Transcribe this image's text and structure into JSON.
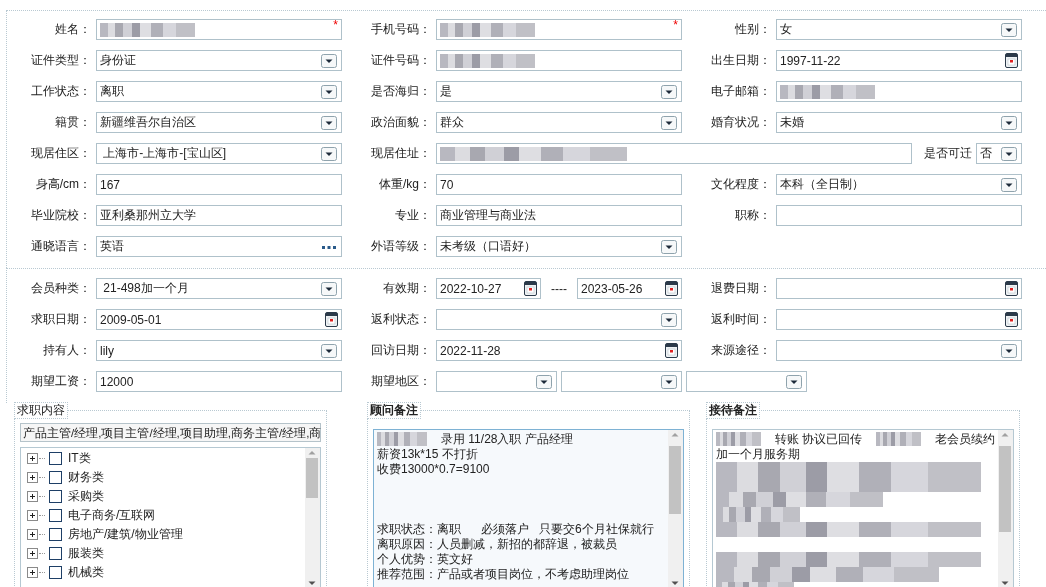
{
  "sections": [
    {
      "rows": [
        [
          {
            "label": "姓名：",
            "fields": [
              {
                "kind": "text",
                "redacted": true,
                "required_mark": "*"
              }
            ]
          },
          {
            "label": "手机号码：",
            "fields": [
              {
                "kind": "text",
                "redacted": true,
                "required_mark": "*"
              }
            ]
          },
          {
            "label": "性别：",
            "fields": [
              {
                "kind": "select",
                "value": "女"
              }
            ]
          }
        ],
        [
          {
            "label": "证件类型：",
            "fields": [
              {
                "kind": "select",
                "value": "身份证"
              }
            ]
          },
          {
            "label": "证件号码：",
            "fields": [
              {
                "kind": "text",
                "redacted": true
              }
            ]
          },
          {
            "label": "出生日期：",
            "fields": [
              {
                "kind": "date",
                "value": "1997-11-22"
              }
            ]
          }
        ],
        [
          {
            "label": "工作状态：",
            "fields": [
              {
                "kind": "select",
                "value": "离职"
              }
            ]
          },
          {
            "label": "是否海归：",
            "fields": [
              {
                "kind": "select",
                "value": "是"
              }
            ]
          },
          {
            "label": "电子邮箱：",
            "fields": [
              {
                "kind": "text",
                "redacted": true
              }
            ]
          }
        ],
        [
          {
            "label": "籍贯：",
            "fields": [
              {
                "kind": "select",
                "value": "新疆维吾尔自治区"
              }
            ]
          },
          {
            "label": "政治面貌：",
            "fields": [
              {
                "kind": "select",
                "value": "群众"
              }
            ]
          },
          {
            "label": "婚育状况：",
            "fields": [
              {
                "kind": "select",
                "value": "未婚"
              }
            ]
          }
        ],
        [
          {
            "label": "现居住区：",
            "fields": [
              {
                "kind": "select",
                "value": " 上海市-上海市-[宝山区]"
              }
            ]
          },
          {
            "label": "现居住址：",
            "fields": [
              {
                "kind": "text",
                "redacted": true
              }
            ],
            "extra": {
              "label": "是否可迁",
              "field": {
                "kind": "select",
                "value": "否"
              }
            }
          }
        ],
        [
          {
            "label": "身高/cm：",
            "fields": [
              {
                "kind": "text",
                "value": "167"
              }
            ]
          },
          {
            "label": "体重/kg：",
            "fields": [
              {
                "kind": "text",
                "value": "70"
              }
            ]
          },
          {
            "label": "文化程度：",
            "fields": [
              {
                "kind": "select",
                "value": "本科（全日制）"
              }
            ]
          }
        ],
        [
          {
            "label": "毕业院校：",
            "fields": [
              {
                "kind": "text",
                "value": "亚利桑那州立大学"
              }
            ]
          },
          {
            "label": "专业：",
            "fields": [
              {
                "kind": "text",
                "value": "商业管理与商业法"
              }
            ]
          },
          {
            "label": "职称：",
            "fields": [
              {
                "kind": "text"
              }
            ]
          }
        ],
        [
          {
            "label": "通晓语言：",
            "fields": [
              {
                "kind": "lookup",
                "value": "英语"
              }
            ]
          },
          {
            "label": "外语等级：",
            "fields": [
              {
                "kind": "select",
                "value": "未考级（口语好）"
              }
            ]
          }
        ]
      ]
    },
    {
      "rows": [
        [
          {
            "label": "会员种类：",
            "fields": [
              {
                "kind": "select",
                "value": " 21-498加一个月"
              }
            ]
          },
          {
            "label": "有效期：",
            "fields": [
              {
                "kind": "date",
                "value": "2022-10-27"
              },
              {
                "kind": "separator",
                "value": "----"
              },
              {
                "kind": "date",
                "value": "2023-05-26"
              }
            ]
          },
          {
            "label": "退费日期：",
            "fields": [
              {
                "kind": "date"
              }
            ]
          }
        ],
        [
          {
            "label": "求职日期：",
            "fields": [
              {
                "kind": "date",
                "value": "2009-05-01"
              }
            ]
          },
          {
            "label": "返利状态：",
            "fields": [
              {
                "kind": "select"
              }
            ]
          },
          {
            "label": "返利时间：",
            "fields": [
              {
                "kind": "date"
              }
            ]
          }
        ],
        [
          {
            "label": "持有人：",
            "fields": [
              {
                "kind": "select",
                "value": "lily"
              }
            ]
          },
          {
            "label": "回访日期：",
            "fields": [
              {
                "kind": "date",
                "value": "2022-11-28"
              }
            ]
          },
          {
            "label": "来源途径：",
            "fields": [
              {
                "kind": "select"
              }
            ]
          }
        ],
        [
          {
            "label": "期望工资：",
            "fields": [
              {
                "kind": "text",
                "value": "12000"
              }
            ]
          },
          {
            "label": "期望地区：",
            "fields": [
              {
                "kind": "select"
              },
              {
                "kind": "select"
              },
              {
                "kind": "select"
              }
            ]
          }
        ]
      ]
    }
  ],
  "job_panel": {
    "legend": "求职内容",
    "selected_text": "产品主管/经理,项目主管/经理,项目助理,商务主管/经理,商",
    "tree": [
      {
        "label": "IT类",
        "expanded": false,
        "checked": false
      },
      {
        "label": "财务类",
        "expanded": false,
        "checked": false
      },
      {
        "label": "采购类",
        "expanded": false,
        "checked": false
      },
      {
        "label": "电子商务/互联网",
        "expanded": false,
        "checked": false
      },
      {
        "label": "房地产/建筑/物业管理",
        "expanded": false,
        "checked": false
      },
      {
        "label": "服装类",
        "expanded": false,
        "checked": false
      },
      {
        "label": "机械类",
        "expanded": false,
        "checked": false
      }
    ]
  },
  "consultant_notes": {
    "legend": "顾问备注",
    "lines": [
      {
        "kind": "mixed",
        "segments": [
          {
            "kind": "blur"
          },
          {
            "kind": "text",
            "text": "录用 11/28入职 产品经理"
          }
        ]
      },
      {
        "kind": "text",
        "text": "薪资13k*15 不打折"
      },
      {
        "kind": "text",
        "text": "收费13000*0.7=9100"
      },
      {
        "kind": "blank"
      },
      {
        "kind": "blank"
      },
      {
        "kind": "blank"
      },
      {
        "kind": "text",
        "text": "求职状态：离职      必须落户   只要交6个月社保就行"
      },
      {
        "kind": "text",
        "text": "离职原因：人员删减，新招的都辞退，被裁员"
      },
      {
        "kind": "text",
        "text": "个人优势：英文好"
      },
      {
        "kind": "text",
        "text": "推荐范围：产品或者项目岗位，不考虑助理岗位"
      }
    ]
  },
  "reception_notes": {
    "legend": "接待备注",
    "lines": [
      {
        "kind": "mixed",
        "segments": [
          {
            "kind": "blur"
          },
          {
            "kind": "text",
            "text": "转账 协议已回传"
          },
          {
            "kind": "blur"
          },
          {
            "kind": "text",
            "text": "老会员续约"
          }
        ]
      },
      {
        "kind": "text",
        "text": "加一个月服务期"
      },
      {
        "kind": "blur"
      },
      {
        "kind": "blur"
      },
      {
        "kind": "blur"
      },
      {
        "kind": "blur"
      },
      {
        "kind": "blur"
      },
      {
        "kind": "blank"
      },
      {
        "kind": "blur"
      },
      {
        "kind": "blur"
      },
      {
        "kind": "blur"
      }
    ]
  }
}
